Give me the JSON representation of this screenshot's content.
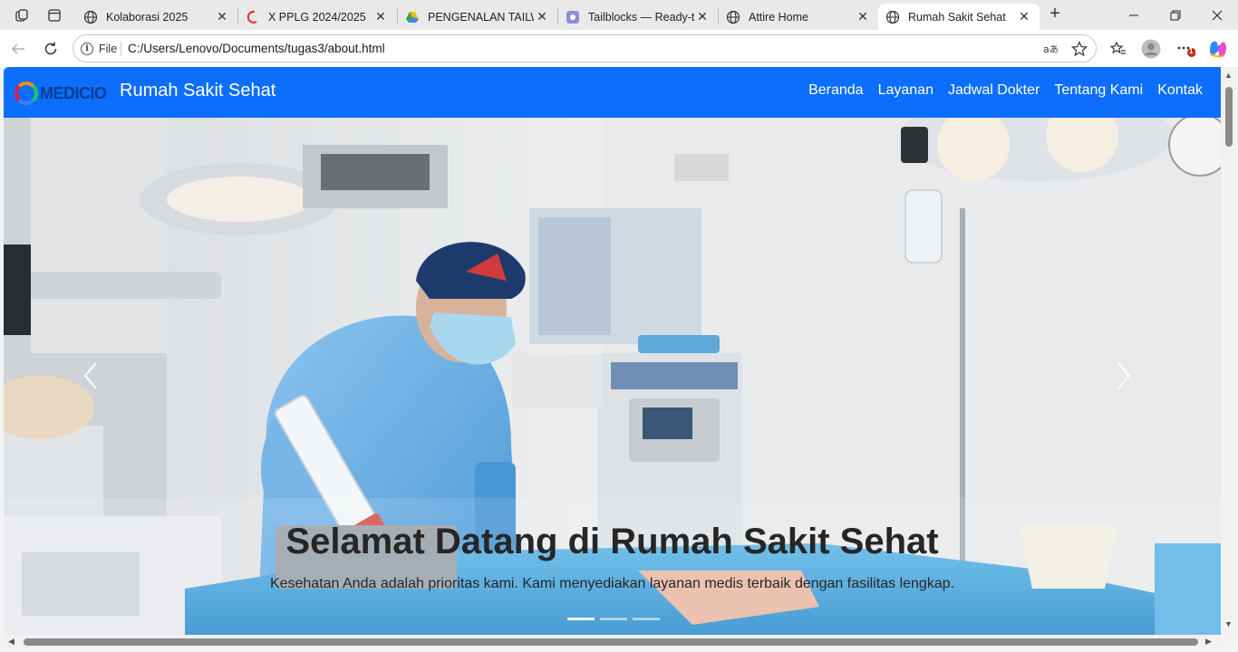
{
  "browser": {
    "tabs": [
      {
        "title": "Kolaborasi 2025",
        "icon": "globe-icon",
        "active": false
      },
      {
        "title": "X PPLG 2024/2025",
        "icon": "classroom-icon",
        "active": false
      },
      {
        "title": "PENGENALAN TAILWI",
        "icon": "drive-icon",
        "active": false
      },
      {
        "title": "Tailblocks — Ready-to",
        "icon": "tailblocks-icon",
        "active": false
      },
      {
        "title": "Attire Home",
        "icon": "globe-icon",
        "active": false
      },
      {
        "title": "Rumah Sakit Sehat",
        "icon": "globe-icon",
        "active": true
      }
    ],
    "address": {
      "scheme_label": "File",
      "url": "C:/Users/Lenovo/Documents/tugas3/about.html"
    },
    "notification_badge": "1"
  },
  "site": {
    "logo_text": "MEDICIO",
    "brand": "Rumah Sakit Sehat",
    "nav": [
      "Beranda",
      "Layanan",
      "Jadwal Dokter",
      "Tentang Kami",
      "Kontak"
    ],
    "colors": {
      "navbar": "#0d6efd",
      "caption_text": "#262626"
    }
  },
  "hero": {
    "title": "Selamat Datang di Rumah Sakit Sehat",
    "text": "Kesehatan Anda adalah prioritas kami. Kami menyediakan layanan medis terbaik dengan fasilitas lengkap.",
    "prev_icon": "chevron-left-icon",
    "next_icon": "chevron-right-icon",
    "slides_count": 3,
    "active_slide": 1
  }
}
